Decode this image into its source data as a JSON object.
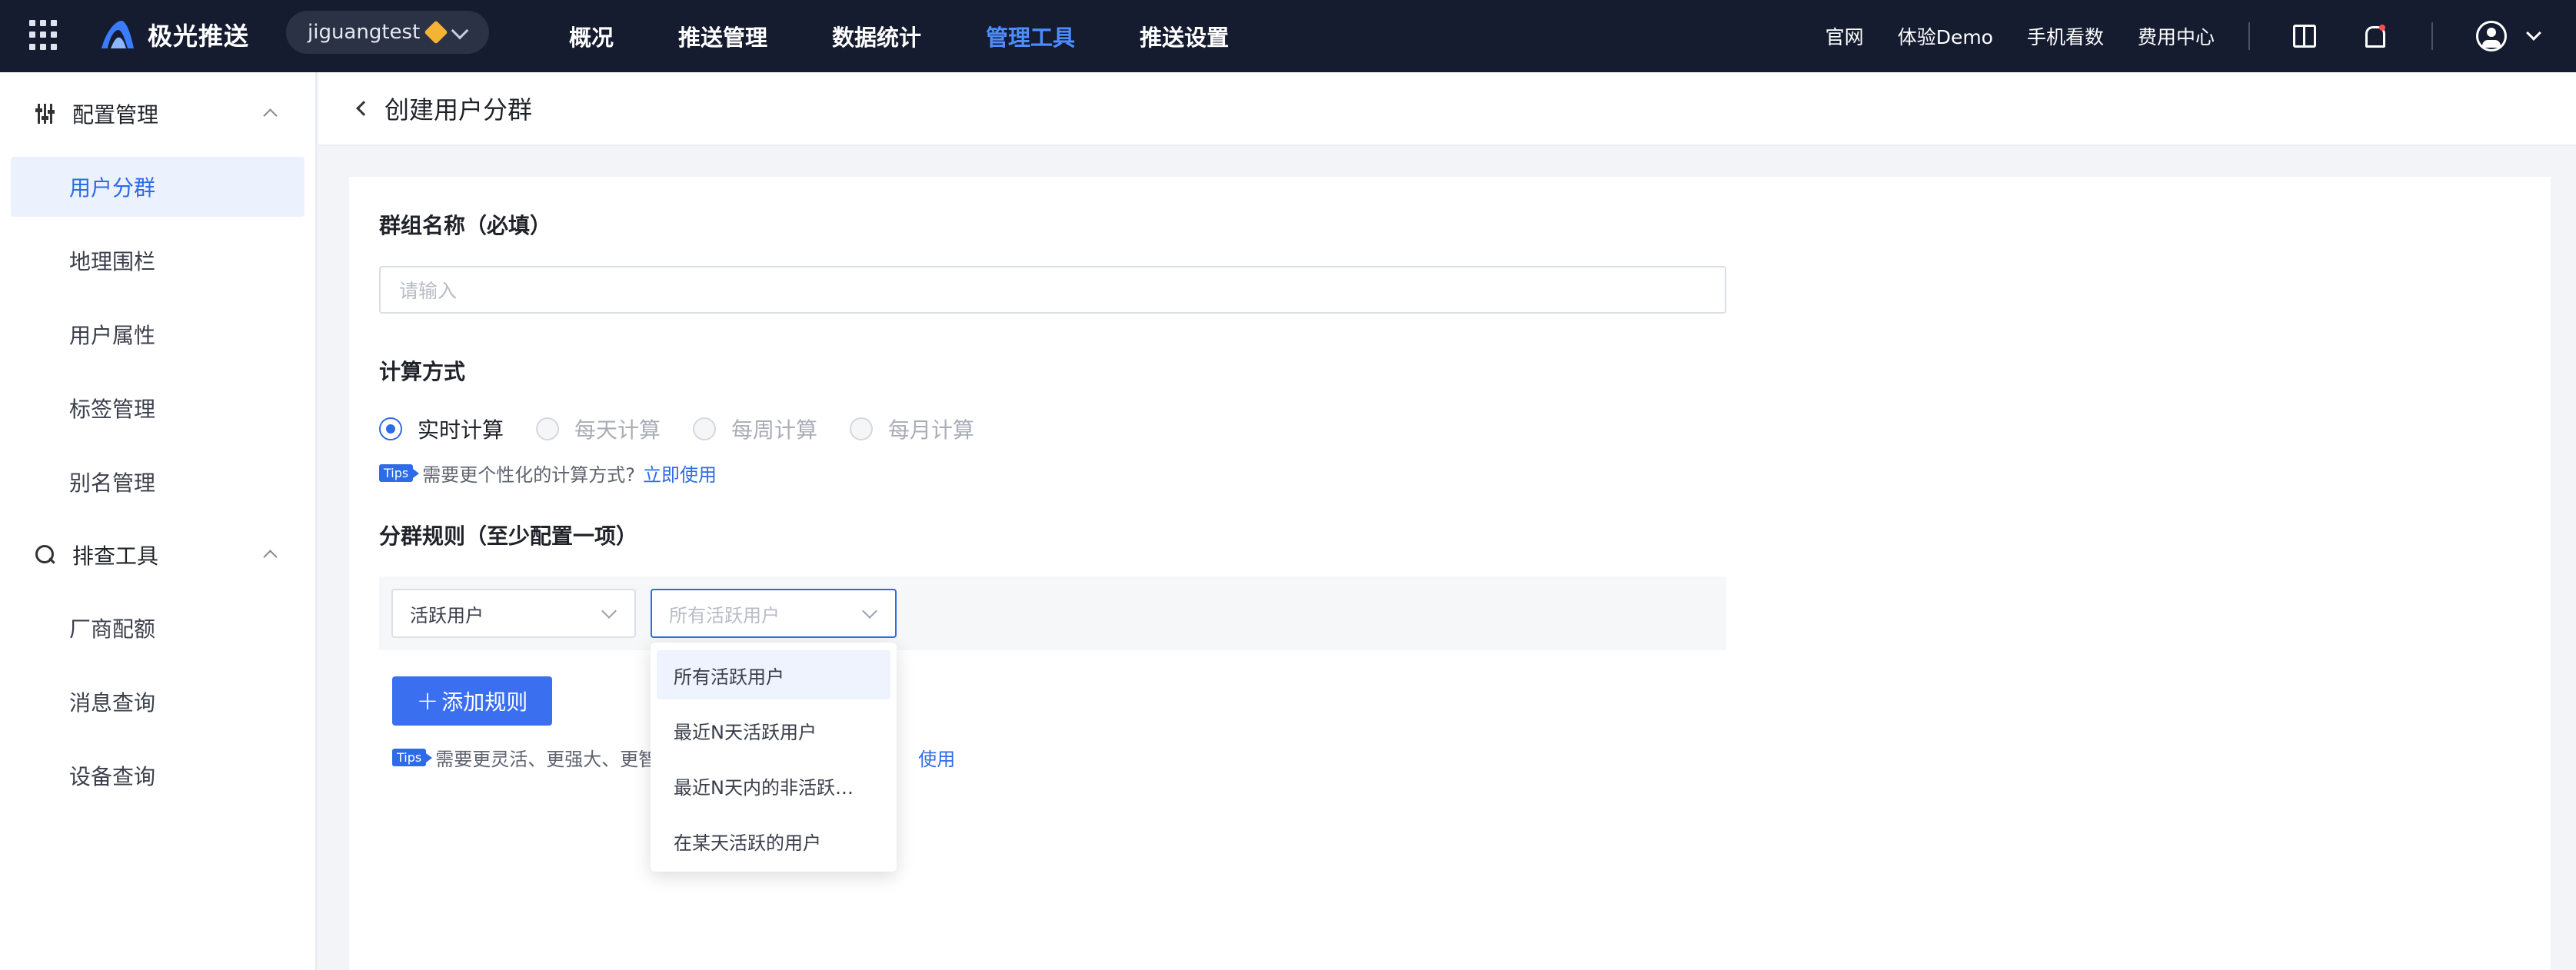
{
  "topbar": {
    "logo_text": "极光推送",
    "account": "jiguangtest",
    "nav": [
      {
        "label": "概况",
        "active": false
      },
      {
        "label": "推送管理",
        "active": false
      },
      {
        "label": "数据统计",
        "active": false
      },
      {
        "label": "管理工具",
        "active": true
      },
      {
        "label": "推送设置",
        "active": false
      }
    ],
    "links": [
      "官网",
      "体验Demo",
      "手机看数",
      "费用中心"
    ]
  },
  "sidebar": {
    "groups": [
      {
        "label": "配置管理",
        "icon": "sliders-icon",
        "items": [
          "用户分群",
          "地理围栏",
          "用户属性",
          "标签管理",
          "别名管理"
        ]
      },
      {
        "label": "排查工具",
        "icon": "zoom-icon",
        "items": [
          "厂商配额",
          "消息查询",
          "设备查询"
        ]
      }
    ],
    "active_item": "用户分群"
  },
  "page": {
    "title": "创建用户分群"
  },
  "form": {
    "name_label": "群组名称（必填）",
    "name_placeholder": "请输入",
    "calc_label": "计算方式",
    "calc_options": [
      "实时计算",
      "每天计算",
      "每周计算",
      "每月计算"
    ],
    "calc_selected": "实时计算",
    "calc_tip_badge": "Tips",
    "calc_tip_text": "需要更个性化的计算方式?",
    "calc_tip_link": "立即使用",
    "rules_label": "分群规则（至少配置一项）",
    "rule_type": "活跃用户",
    "rule_value_placeholder": "所有活跃用户",
    "add_rule": "添加规则",
    "rule_tip_badge": "Tips",
    "rule_tip_text": "需要更灵活、更强大、更智",
    "rule_tip_link": "使用"
  },
  "dropdown": {
    "options": [
      "所有活跃用户",
      "最近N天活跃用户",
      "最近N天内的非活跃…",
      "在某天活跃的用户"
    ],
    "highlighted": "所有活跃用户"
  },
  "colors": {
    "topbar_bg": "#151c30",
    "accent": "#2e6be6",
    "nav_active": "#4d8dff"
  }
}
